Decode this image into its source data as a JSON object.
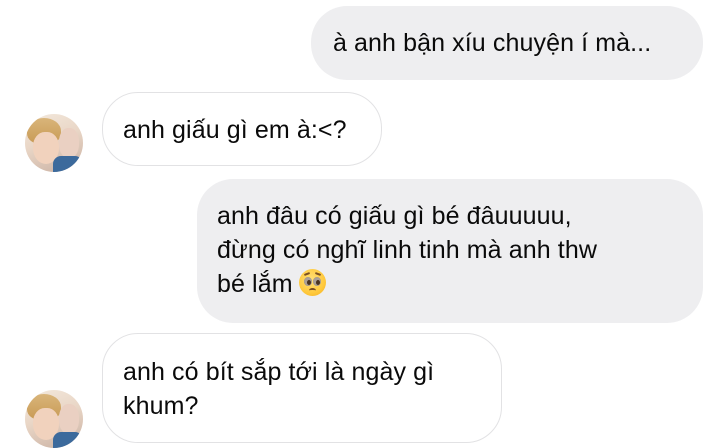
{
  "messages": [
    {
      "id": "m1",
      "direction": "sent",
      "lines": [
        "à anh bận xíu chuyện í mà..."
      ]
    },
    {
      "id": "m2",
      "direction": "received",
      "lines": [
        "anh giấu gì em à:<?"
      ]
    },
    {
      "id": "m3",
      "direction": "sent",
      "lines": [
        "anh đâu có giấu gì bé đâuuuuu,",
        "đừng có nghĩ linh tinh mà anh thw",
        "bé lắm"
      ],
      "trailing_emoji": "pleading-face-emoji"
    },
    {
      "id": "m4",
      "direction": "received",
      "lines": [
        "anh có bít sắp tới là ngày gì",
        "khum?"
      ]
    }
  ],
  "colors": {
    "sent_bubble": "#eeeef0",
    "received_bubble": "#ffffff",
    "received_border": "#e2e2e4",
    "text": "#0a0a0a"
  },
  "icons": {
    "avatar": "contact-avatar-photo",
    "emoji": "pleading-face-emoji"
  }
}
